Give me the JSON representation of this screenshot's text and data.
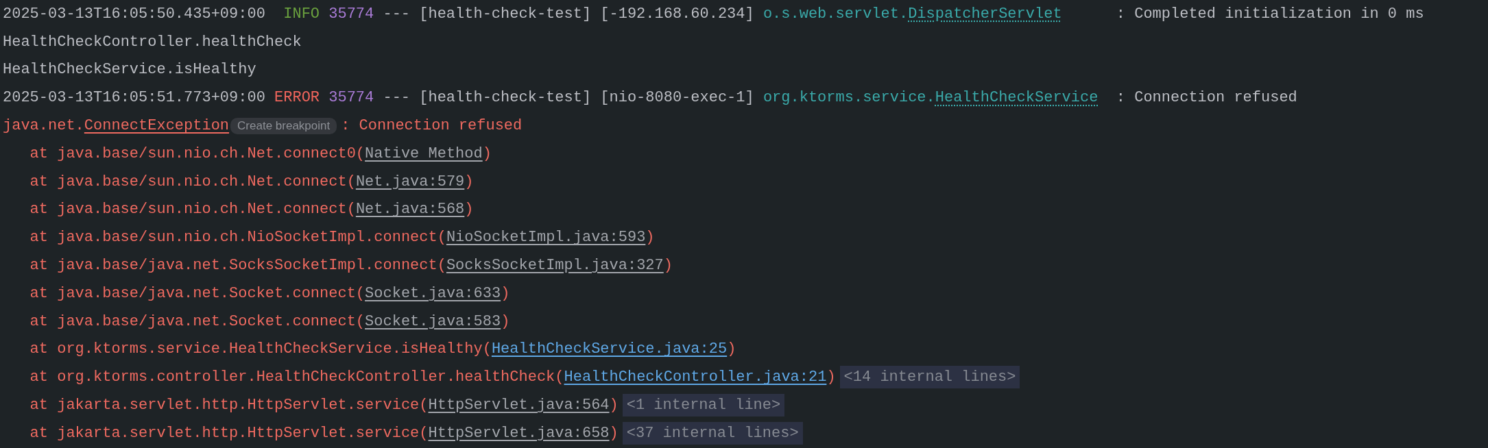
{
  "console": {
    "lines": [
      {
        "kind": "log",
        "timestamp": "2025-03-13T16:05:50.435+09:00",
        "severity": {
          "text": "INFO",
          "kind": "info"
        },
        "pid": "35774",
        "separator": "---",
        "app": "[health-check-test]",
        "thread": "[-192.168.60.234]",
        "logger_package": "o.s.web.servlet.",
        "logger_class": "DispatcherServlet",
        "message": ": Completed initialization in 0 ms"
      },
      {
        "kind": "plain",
        "text": "HealthCheckController.healthCheck"
      },
      {
        "kind": "plain",
        "text": "HealthCheckService.isHealthy"
      },
      {
        "kind": "log",
        "timestamp": "2025-03-13T16:05:51.773+09:00",
        "severity": {
          "text": "ERROR",
          "kind": "error"
        },
        "pid": "35774",
        "separator": "---",
        "app": "[health-check-test]",
        "thread": "[nio-8080-exec-1]",
        "logger_package": "org.ktorms.service.",
        "logger_class": "HealthCheckService",
        "message": ": Connection refused"
      },
      {
        "kind": "exception",
        "package": "java.net.",
        "class": "ConnectException",
        "hint": "Create breakpoint",
        "message": ": Connection refused"
      },
      {
        "kind": "frame",
        "call": "at java.base/sun.nio.ch.Net.connect0(",
        "source": {
          "text": "Native Method",
          "kind": "library"
        },
        "close": ")"
      },
      {
        "kind": "frame",
        "call": "at java.base/sun.nio.ch.Net.connect(",
        "source": {
          "text": "Net.java:579",
          "kind": "library"
        },
        "close": ")"
      },
      {
        "kind": "frame",
        "call": "at java.base/sun.nio.ch.Net.connect(",
        "source": {
          "text": "Net.java:568",
          "kind": "library"
        },
        "close": ")"
      },
      {
        "kind": "frame",
        "call": "at java.base/sun.nio.ch.NioSocketImpl.connect(",
        "source": {
          "text": "NioSocketImpl.java:593",
          "kind": "library"
        },
        "close": ")"
      },
      {
        "kind": "frame",
        "call": "at java.base/java.net.SocksSocketImpl.connect(",
        "source": {
          "text": "SocksSocketImpl.java:327",
          "kind": "library"
        },
        "close": ")"
      },
      {
        "kind": "frame",
        "call": "at java.base/java.net.Socket.connect(",
        "source": {
          "text": "Socket.java:633",
          "kind": "library"
        },
        "close": ")"
      },
      {
        "kind": "frame",
        "call": "at java.base/java.net.Socket.connect(",
        "source": {
          "text": "Socket.java:583",
          "kind": "library"
        },
        "close": ")"
      },
      {
        "kind": "frame",
        "call": "at org.ktorms.service.HealthCheckService.isHealthy(",
        "source": {
          "text": "HealthCheckService.java:25",
          "kind": "project"
        },
        "close": ")"
      },
      {
        "kind": "frame",
        "call": "at org.ktorms.controller.HealthCheckController.healthCheck(",
        "source": {
          "text": "HealthCheckController.java:21",
          "kind": "project"
        },
        "close": ")",
        "folded": "<14 internal lines>"
      },
      {
        "kind": "frame",
        "call": "at jakarta.servlet.http.HttpServlet.service(",
        "source": {
          "text": "HttpServlet.java:564",
          "kind": "library"
        },
        "close": ")",
        "folded": "<1 internal line>"
      },
      {
        "kind": "frame",
        "call": "at jakarta.servlet.http.HttpServlet.service(",
        "source": {
          "text": "HttpServlet.java:658",
          "kind": "library"
        },
        "close": ")",
        "folded": "<37 internal lines>"
      }
    ]
  }
}
